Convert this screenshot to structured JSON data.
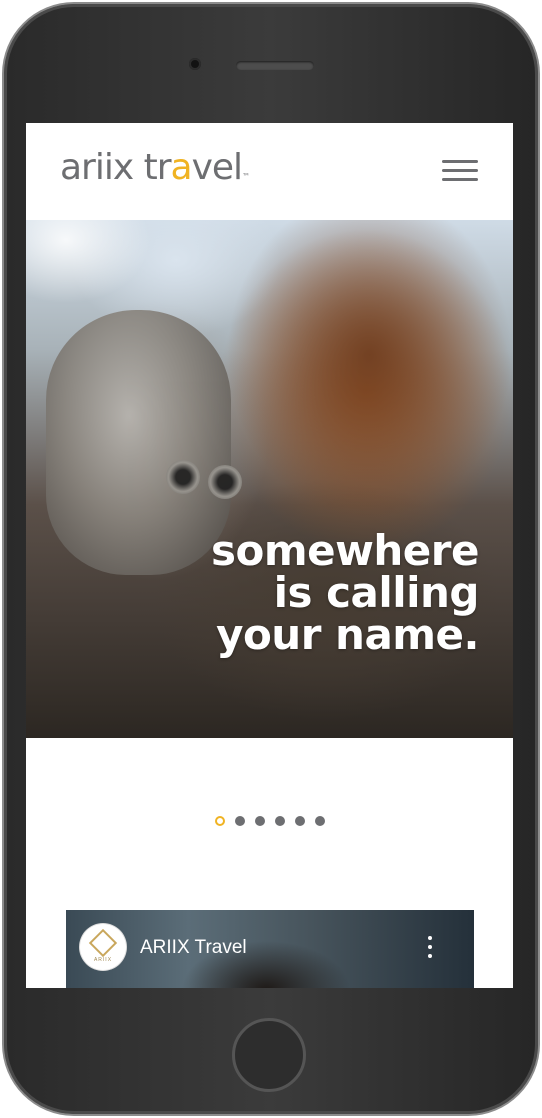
{
  "header": {
    "logo_main": "ariix tr",
    "logo_accent": "a",
    "logo_end": "vel",
    "logo_tm": "™",
    "menu_icon": "hamburger-menu-icon"
  },
  "hero": {
    "headline_lines": [
      "somewhere",
      "is calling",
      "your name."
    ]
  },
  "carousel": {
    "active_index": 0,
    "dot_count": 6,
    "accent_color": "#f0b323",
    "inactive_color": "#6d6e71"
  },
  "video": {
    "channel_name": "ARIIX Travel",
    "avatar_text": "ARIIX",
    "more_icon": "more-vertical-icon"
  }
}
